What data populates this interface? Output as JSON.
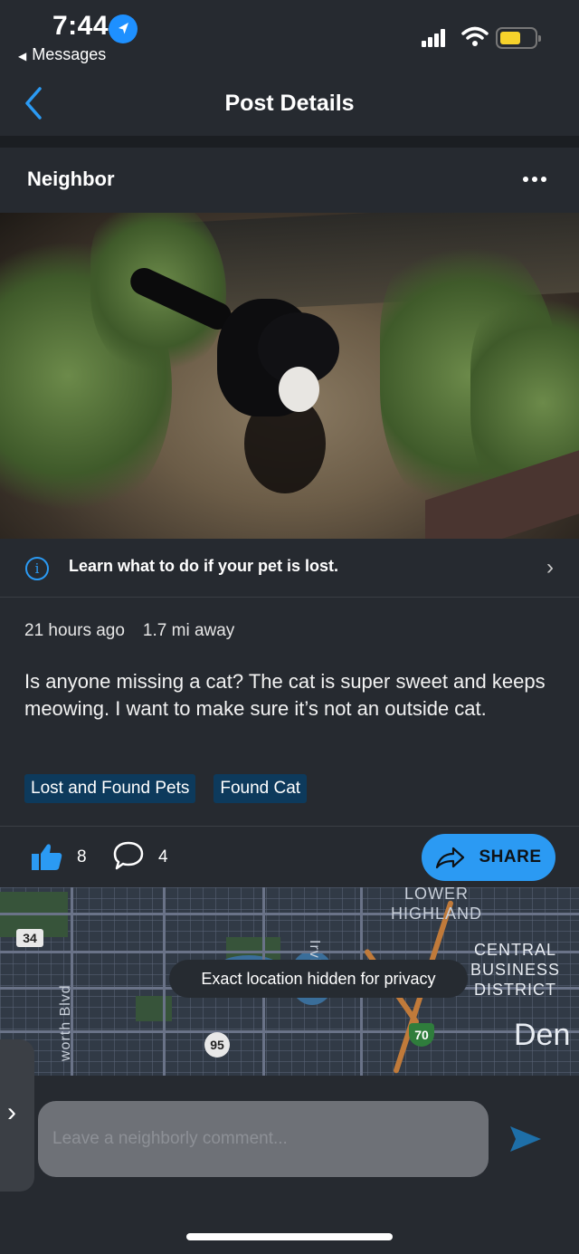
{
  "status_bar": {
    "time": "7:44",
    "back_app": "Messages",
    "location_icon": "location-arrow-icon",
    "battery_color": "#f6d22b"
  },
  "nav": {
    "back_icon": "chevron-left-icon",
    "title": "Post Details"
  },
  "post": {
    "author": "Neighbor",
    "more_icon": "ellipsis-icon",
    "photo_icon": "photo-of-black-and-white-cat",
    "info_banner": {
      "icon": "info-icon",
      "text": "Learn what to do if your pet is lost.",
      "chevron": "chevron-right-icon"
    },
    "time_ago": "21 hours ago",
    "distance": "1.7 mi away",
    "body": "Is anyone missing a cat?  The cat is super sweet and keeps meowing. I want to make sure it’s not an outside cat.",
    "tags": [
      "Lost and Found Pets",
      "Found Cat"
    ],
    "actions": {
      "like_icon": "thumbs-up-icon",
      "like_count": "8",
      "comment_icon": "comment-bubble-icon",
      "comment_count": "4",
      "share_icon": "share-arrow-icon",
      "share_label": "SHARE"
    }
  },
  "map": {
    "labels": {
      "lower_highland": "LOWER\nHIGHLAND",
      "cbd": "CENTRAL\nBUSINESS\nDISTRICT",
      "den": "Den",
      "irvi": "Irvi",
      "worth_blvd": "worth Blvd"
    },
    "shields": {
      "route_34": "34",
      "route_95": "95",
      "interstate_70": "70"
    },
    "privacy_text": "Exact location hidden for privacy"
  },
  "comment": {
    "placeholder": "Leave a neighborly comment...",
    "send_icon": "send-icon",
    "side_icon": "chevron-right-icon"
  },
  "colors": {
    "background": "#262a30",
    "accent": "#2b9af3",
    "tag_bg": "#0d3a5c"
  }
}
